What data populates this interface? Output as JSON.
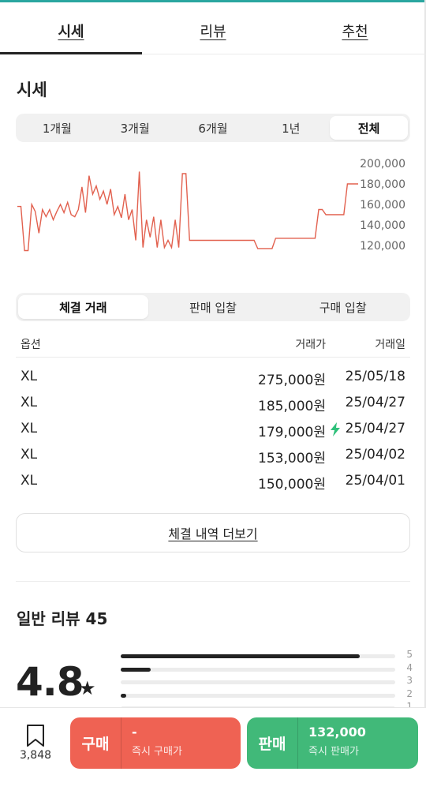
{
  "tabs": [
    {
      "label": "시세",
      "active": true
    },
    {
      "label": "리뷰",
      "active": false
    },
    {
      "label": "추천",
      "active": false
    }
  ],
  "price_section": {
    "title": "시세",
    "periods": [
      "1개월",
      "3개월",
      "6개월",
      "1년",
      "전체"
    ],
    "active_period": "전체"
  },
  "chart_data": {
    "type": "line",
    "color": "#e2614f",
    "y_ticks": [
      "200,000",
      "180,000",
      "160,000",
      "140,000",
      "120,000"
    ],
    "ylim": [
      110000,
      200000
    ],
    "values": [
      158000,
      158000,
      115000,
      115000,
      160000,
      153000,
      132000,
      155000,
      148000,
      155000,
      145000,
      153000,
      160000,
      152000,
      162000,
      150000,
      148000,
      155000,
      177000,
      152000,
      188000,
      170000,
      178000,
      165000,
      173000,
      160000,
      175000,
      150000,
      158000,
      147000,
      170000,
      145000,
      155000,
      125000,
      192000,
      118000,
      145000,
      128000,
      148000,
      118000,
      145000,
      118000,
      125000,
      118000,
      145000,
      118000,
      190000,
      190000,
      125000,
      125000,
      125000,
      125000,
      125000,
      125000,
      125000,
      125000,
      125000,
      125000,
      125000,
      125000,
      125000,
      125000,
      125000,
      125000,
      125000,
      125000,
      125000,
      117000,
      117000,
      117000,
      117000,
      117000,
      127000,
      127000,
      127000,
      127000,
      127000,
      127000,
      127000,
      127000,
      127000,
      127000,
      127000,
      127000,
      155000,
      155000,
      150000,
      150000,
      150000,
      150000,
      150000,
      150000,
      180000,
      180000,
      180000,
      180000
    ]
  },
  "trade_types": [
    "체결 거래",
    "판매 입찰",
    "구매 입찰"
  ],
  "active_trade_type": "체결 거래",
  "table": {
    "headers": [
      "옵션",
      "거래가",
      "거래일"
    ],
    "rows": [
      {
        "option": "XL",
        "price": "275,000원",
        "date": "25/05/18",
        "quick": false
      },
      {
        "option": "XL",
        "price": "185,000원",
        "date": "25/04/27",
        "quick": false
      },
      {
        "option": "XL",
        "price": "179,000원",
        "date": "25/04/27",
        "quick": true
      },
      {
        "option": "XL",
        "price": "153,000원",
        "date": "25/04/02",
        "quick": false
      },
      {
        "option": "XL",
        "price": "150,000원",
        "date": "25/04/01",
        "quick": false
      }
    ]
  },
  "more_button": "체결 내역 더보기",
  "review": {
    "title": "일반 리뷰 45",
    "rating": "4.8",
    "star": "★",
    "distribution": [
      {
        "label": "5",
        "fraction": 0.87
      },
      {
        "label": "4",
        "fraction": 0.11
      },
      {
        "label": "3",
        "fraction": 0.0
      },
      {
        "label": "2",
        "fraction": 0.02
      },
      {
        "label": "1",
        "fraction": 0.0
      }
    ]
  },
  "bottom_bar": {
    "wish_count": "3,848",
    "buy": {
      "label": "구매",
      "price": "-",
      "sub": "즉시 구매가",
      "color": "#ef6253"
    },
    "sell": {
      "label": "판매",
      "price": "132,000",
      "sub": "즉시 판매가",
      "color": "#41b979"
    }
  }
}
